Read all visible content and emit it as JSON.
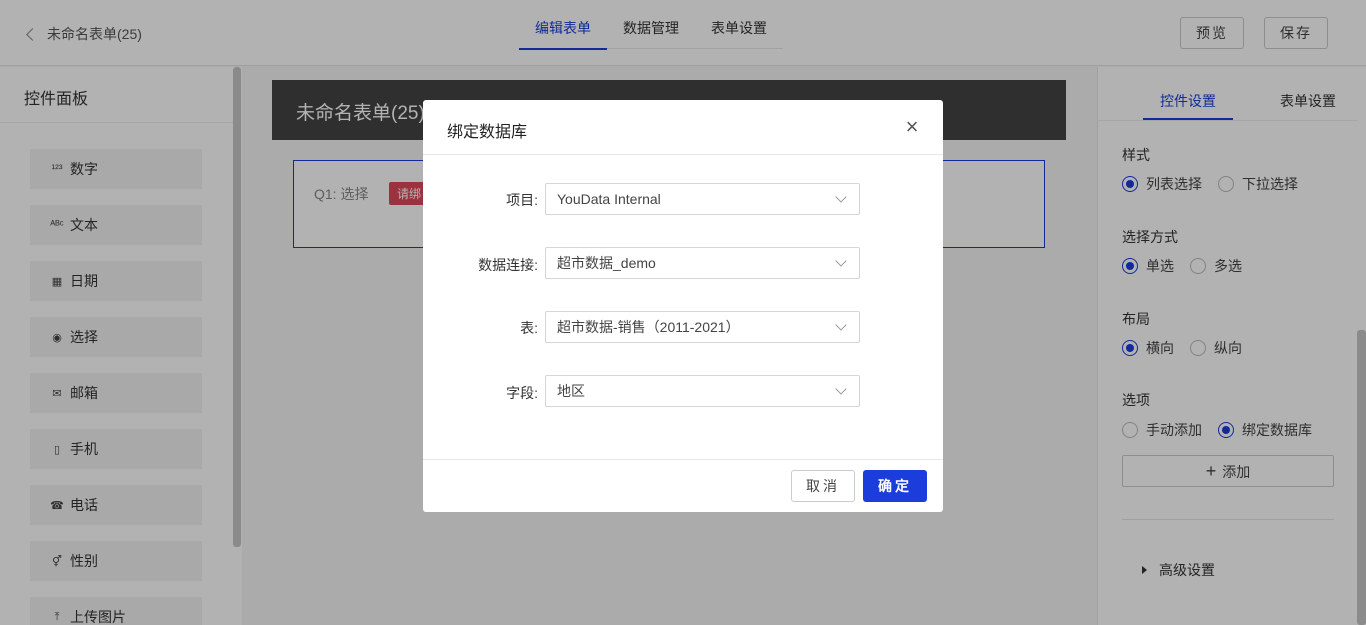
{
  "header": {
    "back_label": "未命名表单(25)",
    "tabs": [
      {
        "label": "编辑表单",
        "active": true
      },
      {
        "label": "数据管理",
        "active": false
      },
      {
        "label": "表单设置",
        "active": false
      }
    ],
    "preview_label": "预览",
    "save_label": "保存"
  },
  "left_panel": {
    "title": "控件面板",
    "components": [
      {
        "icon": "¹²³",
        "label": "数字"
      },
      {
        "icon": "ᴬᴮᶜ",
        "label": "文本"
      },
      {
        "icon": "▦",
        "label": "日期"
      },
      {
        "icon": "◉",
        "label": "选择"
      },
      {
        "icon": "✉",
        "label": "邮箱"
      },
      {
        "icon": "▯",
        "label": "手机"
      },
      {
        "icon": "☎",
        "label": "电话"
      },
      {
        "icon": "⚥",
        "label": "性别"
      },
      {
        "icon": "⤒",
        "label": "上传图片"
      }
    ]
  },
  "form": {
    "title": "未命名表单(25)",
    "question_label": "Q1: 选择",
    "question_tag": "请绑"
  },
  "right_panel": {
    "tabs": [
      {
        "label": "控件设置",
        "active": true
      },
      {
        "label": "表单设置",
        "active": false
      }
    ],
    "style": {
      "label": "样式",
      "options": [
        "列表选择",
        "下拉选择"
      ],
      "selected": 0
    },
    "select_mode": {
      "label": "选择方式",
      "options": [
        "单选",
        "多选"
      ],
      "selected": 0
    },
    "layout": {
      "label": "布局",
      "options": [
        "横向",
        "纵向"
      ],
      "selected": 0
    },
    "options": {
      "label": "选项",
      "choices": [
        "手动添加",
        "绑定数据库"
      ],
      "selected": 1
    },
    "add_label": "添加",
    "advanced_label": "高级设置"
  },
  "modal": {
    "title": "绑定数据库",
    "fields": [
      {
        "label": "项目:",
        "value": "YouData Internal"
      },
      {
        "label": "数据连接:",
        "value": "超市数据_demo"
      },
      {
        "label": "表:",
        "value": "超市数据-销售（2011-2021）"
      },
      {
        "label": "字段:",
        "value": "地区"
      }
    ],
    "cancel_label": "取消",
    "ok_label": "确定"
  },
  "colors": {
    "accent": "#1a3ddb",
    "header_dark": "#444444",
    "tag_red": "#e0485b"
  }
}
